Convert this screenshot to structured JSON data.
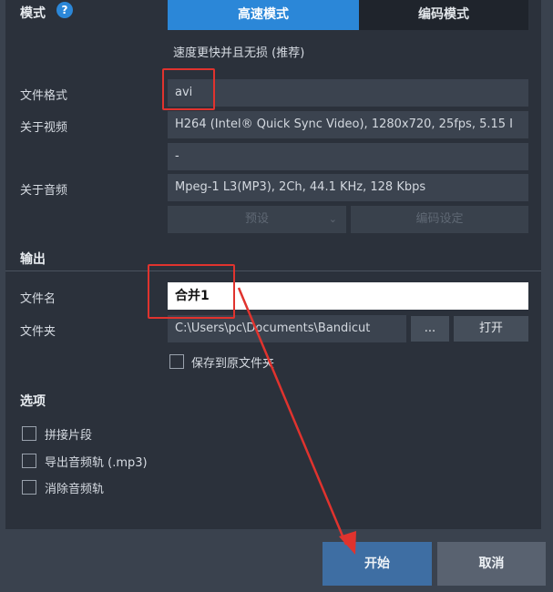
{
  "mode": {
    "label": "模式",
    "help_icon": "help-circle-icon",
    "tabs": [
      "高速模式",
      "编码模式"
    ],
    "active_tab": 0,
    "note": "速度更快并且无损 (推荐)"
  },
  "format": {
    "label": "文件格式",
    "value": "avi"
  },
  "video": {
    "label": "关于视频",
    "value": "H264 (Intel® Quick Sync Video), 1280x720, 25fps, 5.15 I",
    "extra": "-"
  },
  "audio": {
    "label": "关于音频",
    "value": "Mpeg-1 L3(MP3), 2Ch, 44.1 KHz, 128 Kbps",
    "preset_label": "预设",
    "preset_icon": "chevron-down-icon",
    "encode_settings_label": "编码设定"
  },
  "output": {
    "title": "输出",
    "filename_label": "文件名",
    "filename_value": "合并1",
    "folder_label": "文件夹",
    "folder_value": "C:\\Users\\pc\\Documents\\Bandicut",
    "browse_label": "...",
    "open_label": "打开",
    "save_to_source_label": "保存到原文件夹"
  },
  "options": {
    "title": "选项",
    "items": [
      "拼接片段",
      "导出音频轨 (.mp3)",
      "消除音频轨"
    ]
  },
  "footer": {
    "start_label": "开始",
    "cancel_label": "取消"
  },
  "colors": {
    "accent": "#2b87d8",
    "annotation": "#e0332e",
    "panel": "#2b313b",
    "background": "#3a424e"
  }
}
